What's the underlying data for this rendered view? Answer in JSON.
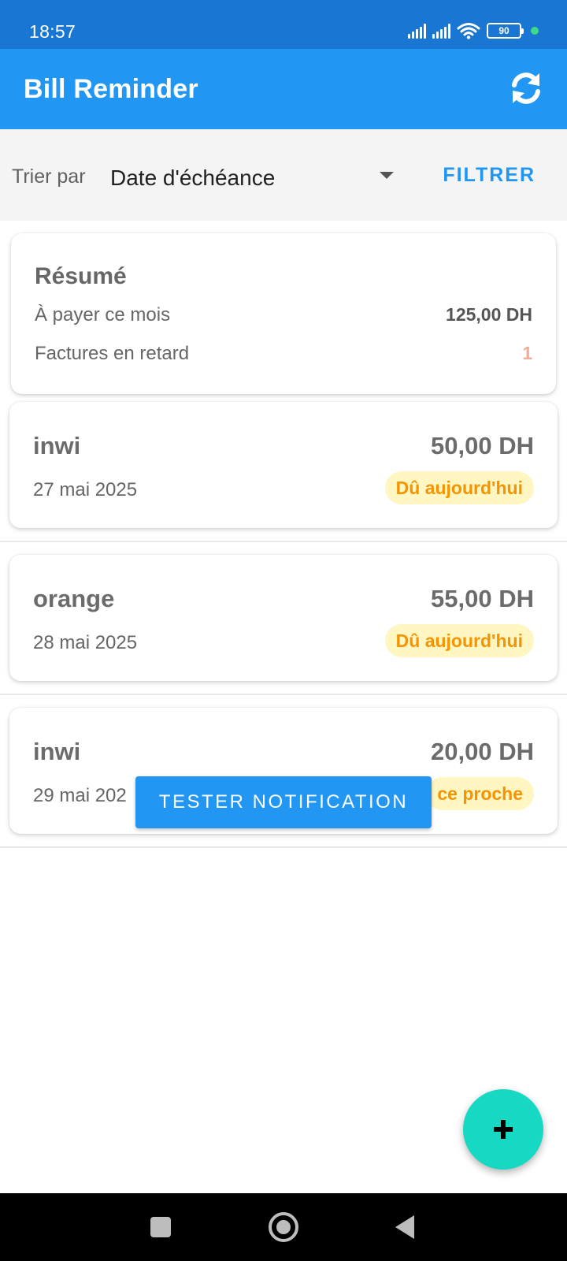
{
  "status_bar": {
    "time": "18:57",
    "battery": "90",
    "icons": [
      "signal-icon",
      "signal-icon",
      "wifi-icon",
      "battery-icon",
      "dot-indicator"
    ]
  },
  "app_bar": {
    "title": "Bill Reminder",
    "refresh_icon": "refresh-icon"
  },
  "sort_bar": {
    "label": "Trier par",
    "selected": "Date d'échéance",
    "filter_label": "FILTRER"
  },
  "summary": {
    "title": "Résumé",
    "to_pay_label": "À payer ce mois",
    "to_pay_value": "125,00 DH",
    "late_label": "Factures en retard",
    "late_value": "1"
  },
  "bills": [
    {
      "name": "inwi",
      "amount": "50,00 DH",
      "date": "27 mai 2025",
      "badge": "Dû aujourd'hui"
    },
    {
      "name": "orange",
      "amount": "55,00 DH",
      "date": "28 mai 2025",
      "badge": "Dû aujourd'hui"
    },
    {
      "name": "inwi",
      "amount": "20,00 DH",
      "date": "29 mai 202",
      "badge": "ce proche"
    }
  ],
  "test_button_label": "TESTER NOTIFICATION",
  "fab_label": "+",
  "colors": {
    "status_bar": "#1976d2",
    "app_bar": "#2196f3",
    "badge_bg": "#fff6c2",
    "badge_text": "#f59300",
    "fab": "#17d9c3"
  }
}
